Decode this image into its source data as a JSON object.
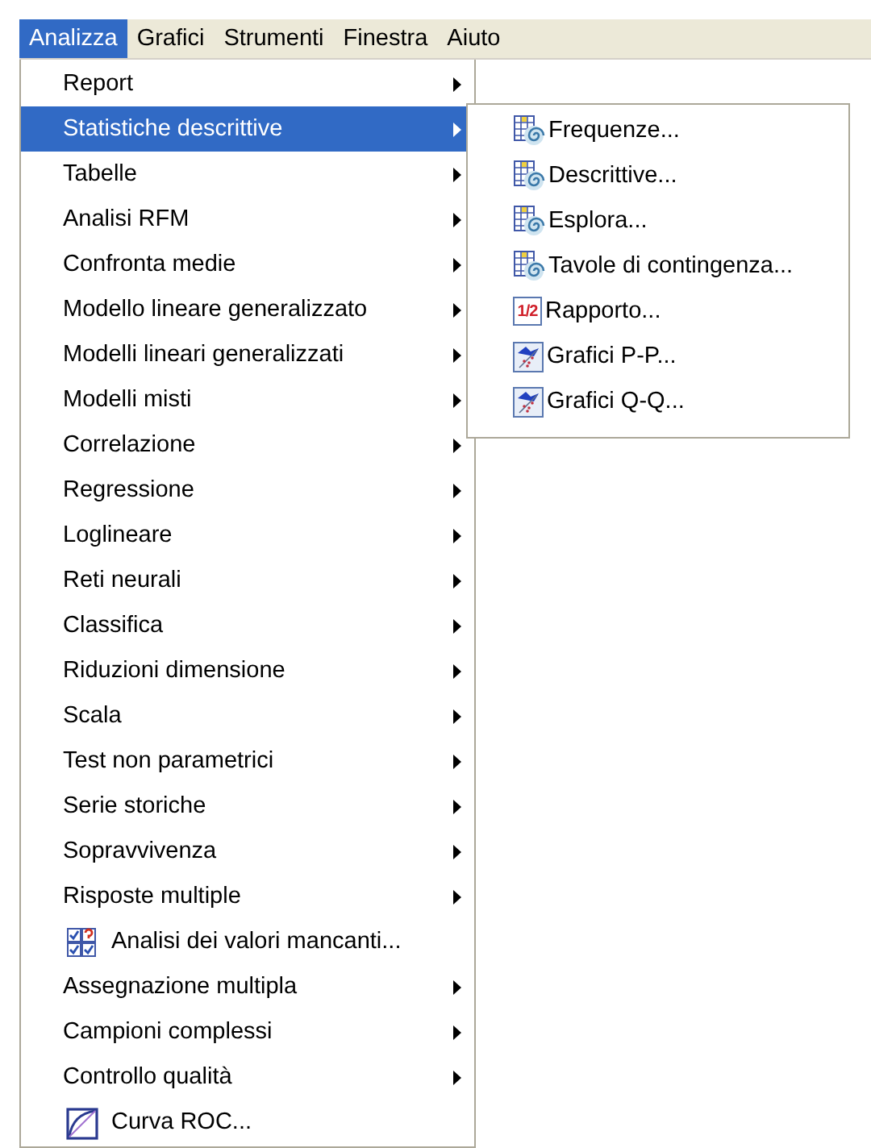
{
  "menubar": [
    {
      "label": "Analizza",
      "selected": true
    },
    {
      "label": "Grafici",
      "selected": false
    },
    {
      "label": "Strumenti",
      "selected": false
    },
    {
      "label": "Finestra",
      "selected": false
    },
    {
      "label": "Aiuto",
      "selected": false
    }
  ],
  "menu": {
    "items": [
      {
        "label": "Report",
        "kind": "submenu",
        "selected": false
      },
      {
        "label": "Statistiche descrittive",
        "kind": "submenu",
        "selected": true,
        "children": [
          {
            "label": "Frequenze...",
            "kind": "spiral-table"
          },
          {
            "label": "Descrittive...",
            "kind": "spiral-table"
          },
          {
            "label": "Esplora...",
            "kind": "spiral-table"
          },
          {
            "label": "Tavole di contingenza...",
            "kind": "spiral-table"
          },
          {
            "label": "Rapporto...",
            "kind": "ratio",
            "icon_text": "1/2"
          },
          {
            "label": "Grafici P-P...",
            "kind": "plot"
          },
          {
            "label": "Grafici Q-Q...",
            "kind": "plot"
          }
        ]
      },
      {
        "label": "Tabelle",
        "kind": "submenu",
        "selected": false
      },
      {
        "label": "Analisi RFM",
        "kind": "submenu",
        "selected": false
      },
      {
        "label": "Confronta medie",
        "kind": "submenu",
        "selected": false
      },
      {
        "label": "Modello lineare generalizzato",
        "kind": "submenu",
        "selected": false
      },
      {
        "label": "Modelli lineari generalizzati",
        "kind": "submenu",
        "selected": false
      },
      {
        "label": "Modelli misti",
        "kind": "submenu",
        "selected": false
      },
      {
        "label": "Correlazione",
        "kind": "submenu",
        "selected": false
      },
      {
        "label": "Regressione",
        "kind": "submenu",
        "selected": false
      },
      {
        "label": "Loglineare",
        "kind": "submenu",
        "selected": false
      },
      {
        "label": "Reti neurali",
        "kind": "submenu",
        "selected": false
      },
      {
        "label": "Classifica",
        "kind": "submenu",
        "selected": false
      },
      {
        "label": "Riduzioni dimensione",
        "kind": "submenu",
        "selected": false
      },
      {
        "label": "Scala",
        "kind": "submenu",
        "selected": false
      },
      {
        "label": "Test non parametrici",
        "kind": "submenu",
        "selected": false
      },
      {
        "label": "Serie storiche",
        "kind": "submenu",
        "selected": false
      },
      {
        "label": "Sopravvivenza",
        "kind": "submenu",
        "selected": false
      },
      {
        "label": "Risposte multiple",
        "kind": "submenu",
        "selected": false
      },
      {
        "label": "Analisi dei valori mancanti...",
        "kind": "check-grid",
        "selected": false
      },
      {
        "label": "Assegnazione multipla",
        "kind": "submenu",
        "selected": false
      },
      {
        "label": "Campioni complessi",
        "kind": "submenu",
        "selected": false
      },
      {
        "label": "Controllo qualità",
        "kind": "submenu",
        "selected": false
      },
      {
        "label": "Curva ROC...",
        "kind": "curve",
        "selected": false
      }
    ]
  }
}
